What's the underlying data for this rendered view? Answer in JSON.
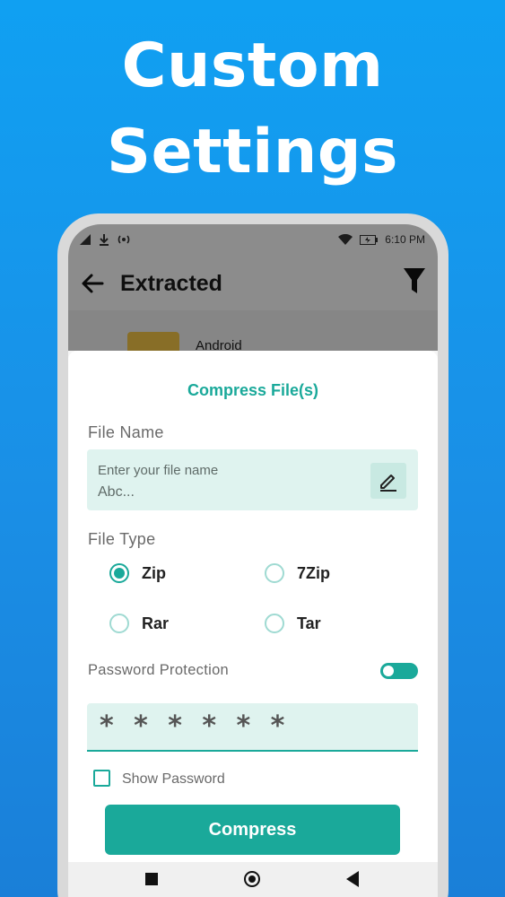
{
  "promo": {
    "line1": "Custom",
    "line2": "Settings"
  },
  "status_bar": {
    "time": "6:10 PM",
    "icons": [
      "signal-icon",
      "download-icon",
      "hotspot-icon",
      "wifi-icon",
      "battery-charging-icon"
    ]
  },
  "app_bar": {
    "title": "Extracted",
    "back_icon": "arrow-left-icon",
    "filter_icon": "filter-icon"
  },
  "background_list": {
    "items": [
      {
        "name": "Android"
      }
    ]
  },
  "dialog": {
    "title": "Compress File(s)",
    "file_name": {
      "label": "File Name",
      "hint": "Enter your file name",
      "value": "Abc...",
      "edit_icon": "pencil-icon"
    },
    "file_type": {
      "label": "File Type",
      "options": [
        {
          "label": "Zip",
          "selected": true
        },
        {
          "label": "7Zip",
          "selected": false
        },
        {
          "label": "Rar",
          "selected": false
        },
        {
          "label": "Tar",
          "selected": false
        }
      ]
    },
    "password_protection": {
      "label": "Password Protection",
      "enabled": true
    },
    "password": {
      "value": "* * * * * *"
    },
    "show_password": {
      "label": "Show Password",
      "checked": false
    },
    "compress_button": "Compress"
  },
  "colors": {
    "accent": "#1aa99a",
    "field_bg": "#dff3ef",
    "promo_bg": "#1a8fe6"
  }
}
